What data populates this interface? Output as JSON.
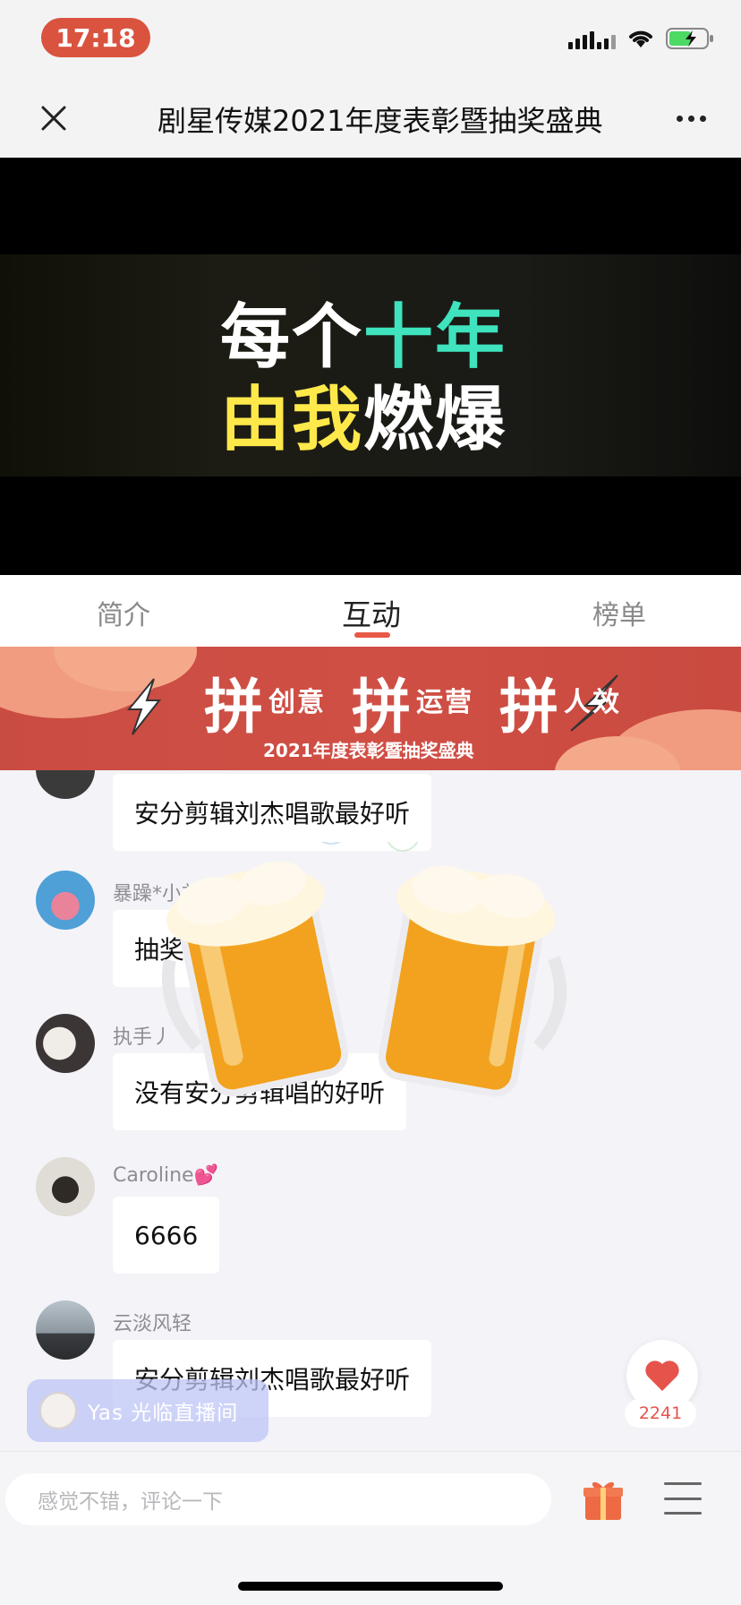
{
  "status_bar": {
    "time": "17:18",
    "battery": "charging"
  },
  "nav": {
    "title": "剧星传媒2021年度表彰暨抽奖盛典",
    "close_icon": "close-icon",
    "more_icon": "more-icon"
  },
  "video": {
    "line1_a": "每个",
    "line1_b": "十年",
    "line2_a": "由我",
    "line2_b": "燃爆"
  },
  "tabs": [
    {
      "label": "简介"
    },
    {
      "label": "互动",
      "active": true
    },
    {
      "label": "榜单"
    }
  ],
  "banner": {
    "main_a": "拼",
    "main_a_small": "创意",
    "main_b": "拼",
    "main_b_small": "运营",
    "main_c": "拼",
    "main_c_small": "人效",
    "sub": "2021年度表彰暨抽奖盛典"
  },
  "messages": [
    {
      "user": "",
      "text": "安分剪辑刘杰唱歌最好听"
    },
    {
      "user": "暴躁*小刘",
      "text": "抽奖"
    },
    {
      "user": "执手丿",
      "text": "没有安分剪辑唱的好听"
    },
    {
      "user": "Caroline💕",
      "text": "6666"
    },
    {
      "user": "云淡风轻",
      "text": "安分剪辑刘杰唱歌最好听"
    }
  ],
  "welcome": {
    "text": "Yas 光临直播间"
  },
  "like": {
    "count": "2241"
  },
  "comment": {
    "placeholder": "感觉不错，评论一下"
  },
  "colors": {
    "accent": "#e5534b",
    "banner": "#c94c42",
    "time_pill": "#d9533f"
  }
}
